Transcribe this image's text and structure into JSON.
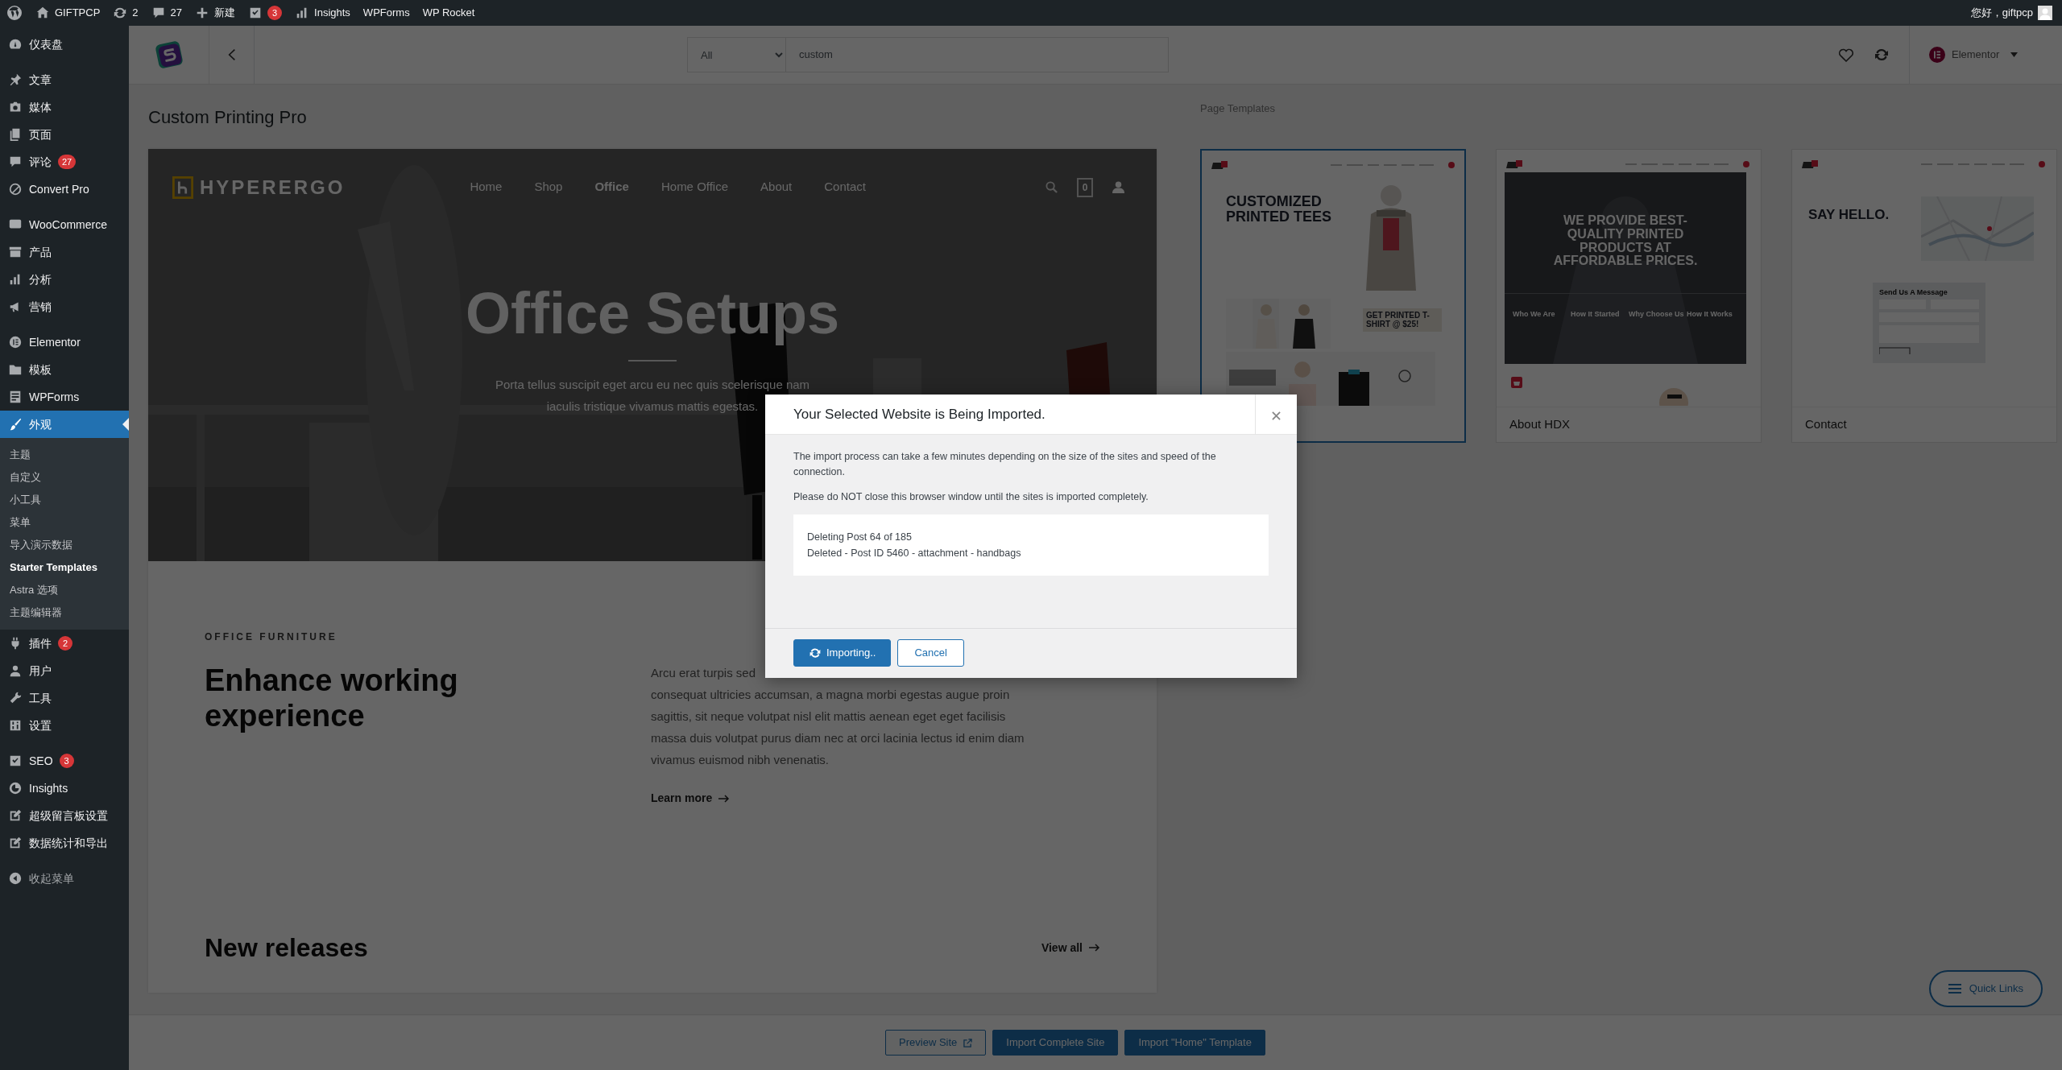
{
  "admin_bar": {
    "items": [
      {
        "kind": "logo"
      },
      {
        "kind": "home",
        "label": "GIFTPCP"
      },
      {
        "kind": "updates",
        "label": "2"
      },
      {
        "kind": "comments",
        "label": "27"
      },
      {
        "kind": "new",
        "label": "新建"
      },
      {
        "kind": "seo",
        "badge": "3"
      },
      {
        "kind": "insights",
        "label": "Insights"
      },
      {
        "kind": "text",
        "label": "WPForms"
      },
      {
        "kind": "text",
        "label": "WP Rocket"
      }
    ],
    "greeting": "您好，giftpcp"
  },
  "sidebar": {
    "groups": [
      [
        {
          "label": "仪表盘",
          "selected": false
        }
      ],
      [
        {
          "label": "文章",
          "selected": false
        },
        {
          "label": "媒体",
          "selected": false
        },
        {
          "label": "页面",
          "selected": false
        },
        {
          "label": "评论",
          "badge": "27",
          "selected": false
        },
        {
          "label": "Convert Pro",
          "selected": false
        }
      ],
      [
        {
          "label": "WooCommerce",
          "selected": false
        },
        {
          "label": "产品",
          "selected": false
        },
        {
          "label": "分析",
          "selected": false
        },
        {
          "label": "营销",
          "selected": false
        }
      ],
      [
        {
          "label": "Elementor",
          "selected": false
        },
        {
          "label": "模板",
          "selected": false
        },
        {
          "label": "WPForms",
          "selected": false
        },
        {
          "label": "外观",
          "selected": true,
          "children": [
            {
              "label": "主题",
              "selected": false
            },
            {
              "label": "自定义",
              "selected": false
            },
            {
              "label": "小工具",
              "selected": false
            },
            {
              "label": "菜单",
              "selected": false
            },
            {
              "label": "导入演示数据",
              "selected": false
            },
            {
              "label": "Starter Templates",
              "selected": true
            },
            {
              "label": "Astra 选项",
              "selected": false
            },
            {
              "label": "主题编辑器",
              "selected": false
            }
          ]
        },
        {
          "label": "插件",
          "badge": "2",
          "selected": false
        },
        {
          "label": "用户",
          "selected": false
        },
        {
          "label": "工具",
          "selected": false
        },
        {
          "label": "设置",
          "selected": false
        }
      ],
      [
        {
          "label": "SEO",
          "badge": "3",
          "selected": false
        },
        {
          "label": "Insights",
          "selected": false
        },
        {
          "label": "超级留言板设置",
          "selected": false
        },
        {
          "label": "数据统计和导出",
          "selected": false
        }
      ]
    ],
    "collapse": "收起菜单"
  },
  "toolbar": {
    "filter": "All",
    "search": "custom",
    "builder": "Elementor"
  },
  "preview": {
    "title": "Custom Printing Pro",
    "brand": "HYPERERGO",
    "nav": [
      {
        "label": "Home",
        "selected": false
      },
      {
        "label": "Shop",
        "selected": false
      },
      {
        "label": "Office",
        "selected": true
      },
      {
        "label": "Home Office",
        "selected": false
      },
      {
        "label": "About",
        "selected": false
      },
      {
        "label": "Contact",
        "selected": false
      }
    ],
    "cart_count": "0",
    "hero_title": "Office Setups",
    "hero_lines": [
      "Porta tellus suscipit eget arcu eu nec quis scelerisque nam",
      "iaculis tristique vivamus mattis egestas."
    ],
    "eyebrow": "OFFICE FURNITURE",
    "heading": "Enhance working experience",
    "text_first": "Arcu erat turpis sed",
    "text_rest": "consequat ultricies accumsan, a magna morbi egestas augue proin sagittis, sit neque volutpat nisl elit mattis aenean eget eget facilisis massa duis volutpat purus diam nec at orci lacinia lectus id enim diam vivamus euismod nibh venenatis.",
    "link": "Learn more",
    "section_title": "New releases",
    "section_link": "View all"
  },
  "templates": {
    "title": "Page Templates",
    "items": [
      {
        "kind": "tees",
        "selected": true,
        "headline": "CUSTOMIZED PRINTED TEES",
        "promo": "GET PRINTED T-SHIRT @ $25!"
      },
      {
        "kind": "about",
        "selected": false,
        "headline": "WE PROVIDE BEST-QUALITY PRINTED PRODUCTS AT AFFORDABLE PRICES.",
        "columns": [
          "Who We Are",
          "How It Started",
          "Why Choose Us",
          "How It Works"
        ],
        "caption": "About HDX"
      },
      {
        "kind": "contact",
        "selected": false,
        "headline": "SAY HELLO.",
        "form_title": "Send Us A Message",
        "caption": "Contact"
      }
    ]
  },
  "actions": [
    {
      "kind": "outline",
      "label": "Preview Site"
    },
    {
      "kind": "primary",
      "label": "Import Complete Site"
    },
    {
      "kind": "primary",
      "label": "Import \"Home\" Template"
    }
  ],
  "quick_links": "Quick Links",
  "modal": {
    "title": "Your Selected Website is Being Imported.",
    "paragraphs": [
      "The import process can take a few minutes depending on the size of the sites and speed of the connection.",
      "Please do NOT close this browser window until the sites is imported completely."
    ],
    "log": [
      "Deleting Post 64 of 185",
      "Deleted - Post ID 5460 - attachment - handbags"
    ],
    "primary": "Importing..",
    "secondary": "Cancel"
  }
}
